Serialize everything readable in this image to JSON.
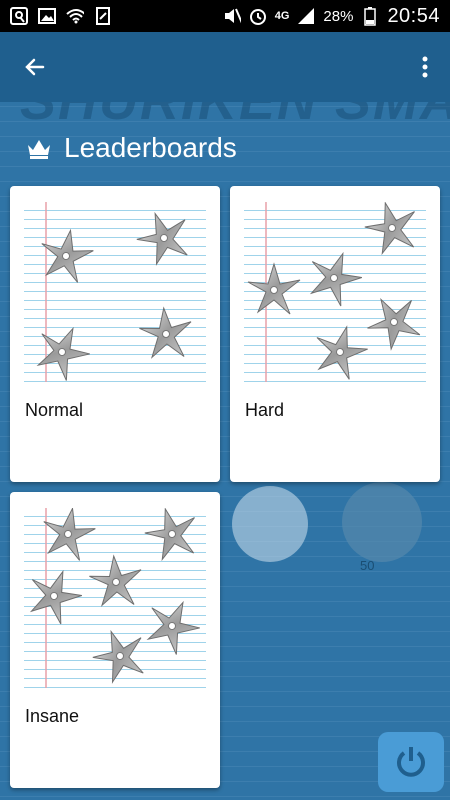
{
  "status_bar": {
    "network": "4G",
    "battery": "28%",
    "time": "20:54"
  },
  "app": {
    "watermark_title": "SHURIKEN SMASH",
    "heading": "Leaderboards"
  },
  "background": {
    "coin_count": "50"
  },
  "leaderboards": [
    {
      "label": "Normal"
    },
    {
      "label": "Hard"
    },
    {
      "label": "Insane"
    }
  ],
  "colors": {
    "app_bar": "#1f5f8e",
    "backdrop": "#2f74a6",
    "card": "#ffffff"
  }
}
